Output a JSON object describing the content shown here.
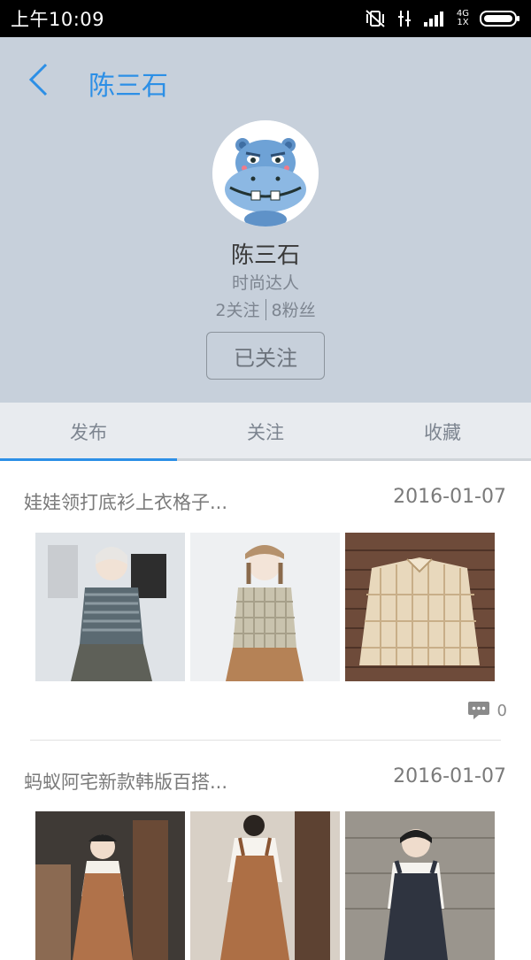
{
  "status_bar": {
    "time": "上午10:09",
    "network_top": "4G",
    "network_bottom": "1X"
  },
  "header": {
    "title": "陈三石",
    "back_icon": "chevron-left-icon"
  },
  "profile": {
    "name": "陈三石",
    "title": "时尚达人",
    "following": "2关注",
    "followers": "8粉丝",
    "follow_button": "已关注"
  },
  "tabs": [
    {
      "label": "发布",
      "active": true
    },
    {
      "label": "关注",
      "active": false
    },
    {
      "label": "收藏",
      "active": false
    }
  ],
  "posts": [
    {
      "title": "娃娃领打底衫上衣格子...",
      "date": "2016-01-07",
      "comments": "0"
    },
    {
      "title": "蚂蚁阿宅新款韩版百搭...",
      "date": "2016-01-07"
    }
  ],
  "colors": {
    "accent": "#2c8fe6",
    "header_bg": "#c7d0db",
    "tab_bg": "#e8ebef"
  }
}
